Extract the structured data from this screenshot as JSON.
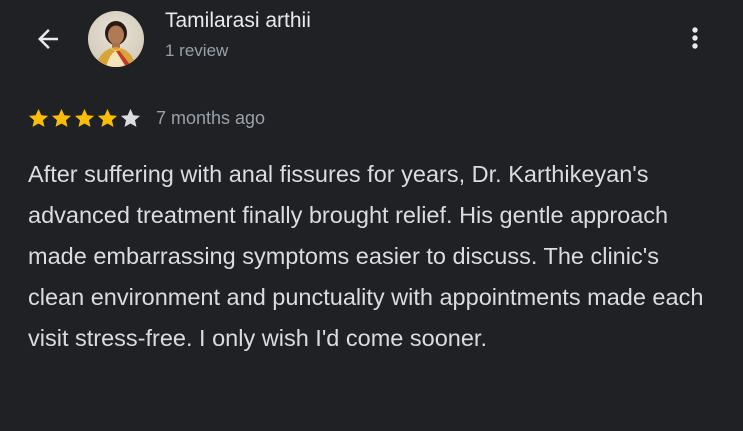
{
  "header": {
    "reviewer_name": "Tamilarasi arthii",
    "review_count": "1 review",
    "back_icon": "arrow-left-icon",
    "more_icon": "more-vert-icon"
  },
  "review": {
    "rating": 4,
    "max_rating": 5,
    "date": "7 months ago",
    "text": "After suffering with anal fissures for years, Dr. Karthikeyan's advanced treatment finally brought relief. His gentle approach made embarrassing symptoms easier to discuss. The clinic's clean environment and punctuality with appointments made each visit stress-free. I only wish I'd come sooner."
  },
  "colors": {
    "background": "#202124",
    "star_filled": "#fbbc04",
    "star_empty": "#dadce0",
    "primary_text": "#e8eaed",
    "secondary_text": "#9aa0a6"
  }
}
